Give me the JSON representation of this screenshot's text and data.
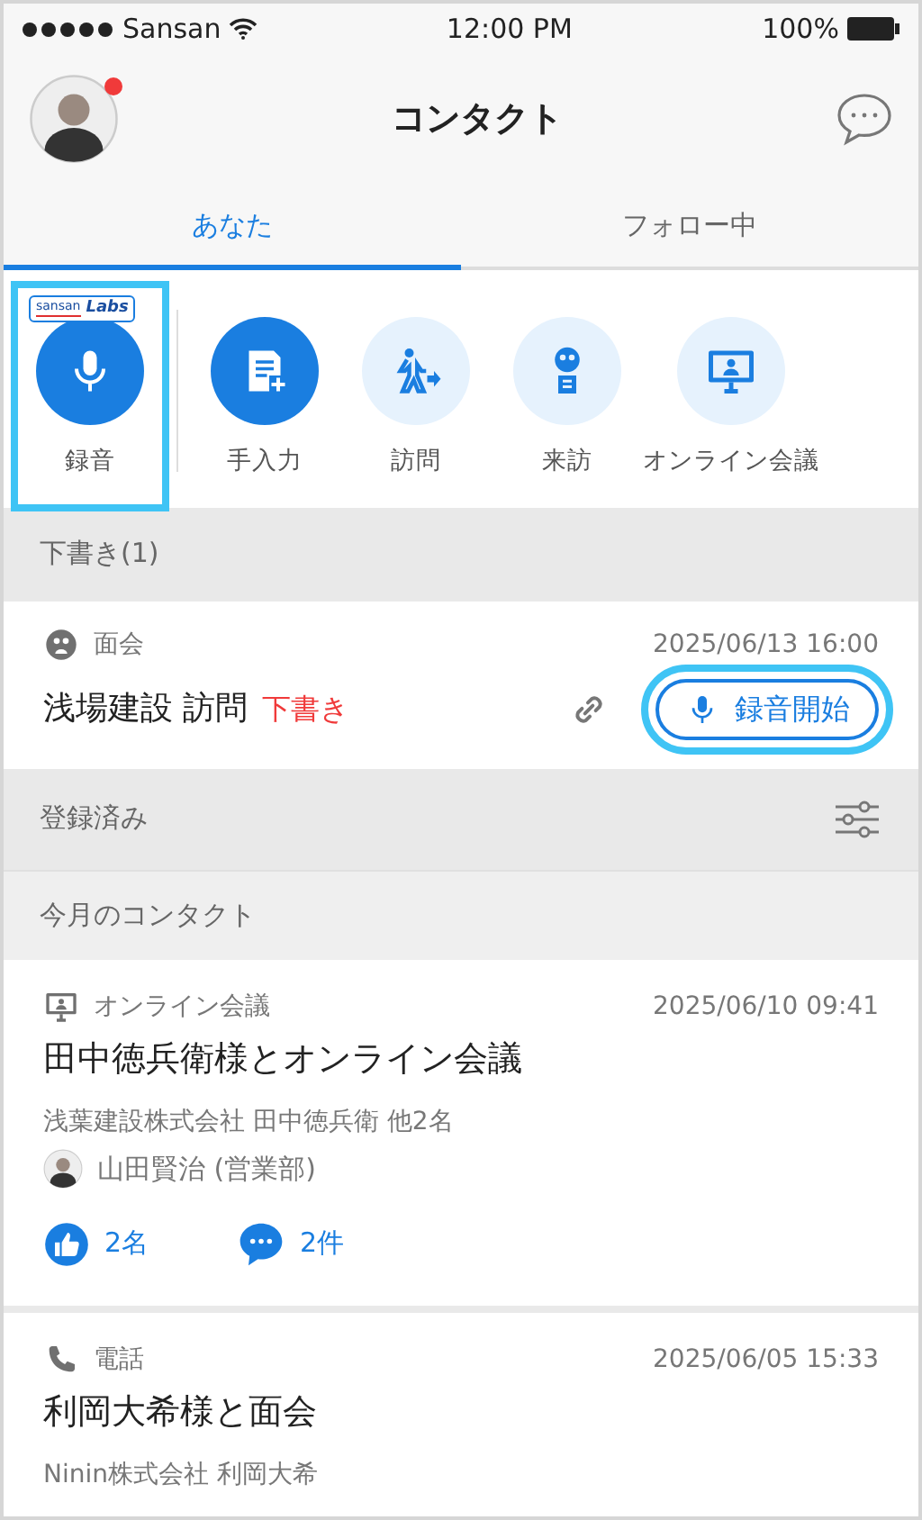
{
  "status_bar": {
    "carrier": "Sansan",
    "time": "12:00 PM",
    "battery": "100%"
  },
  "header": {
    "title": "コンタクト",
    "notification": true
  },
  "tabs": [
    {
      "label": "あなた",
      "selected": true
    },
    {
      "label": "フォロー中",
      "selected": false
    }
  ],
  "actions": [
    {
      "label": "録音",
      "kind": "record",
      "filled": true,
      "highlighted": true,
      "badge": {
        "brand": "sansan",
        "label": "Labs"
      }
    },
    {
      "label": "手入力",
      "kind": "manual",
      "filled": true,
      "highlighted": false
    },
    {
      "label": "訪問",
      "kind": "visit",
      "filled": false,
      "highlighted": false
    },
    {
      "label": "来訪",
      "kind": "reception",
      "filled": false,
      "highlighted": false
    },
    {
      "label": "オンライン会議",
      "kind": "online",
      "filled": false,
      "highlighted": false
    }
  ],
  "drafts": {
    "heading": "下書き(1)",
    "items": [
      {
        "kind": "meeting",
        "type": "面会",
        "datetime": "2025/06/13 16:00",
        "title": "浅場建設 訪問",
        "status": "下書き",
        "record_button": {
          "label": "録音開始",
          "highlighted": true
        }
      }
    ]
  },
  "registered": {
    "heading": "登録済み"
  },
  "month": {
    "heading": "今月のコンタクト"
  },
  "contacts": [
    {
      "kind": "online",
      "type": "オンライン会議",
      "datetime": "2025/06/10 09:41",
      "title": "田中徳兵衛様とオンライン会議",
      "company": "浅葉建設株式会社 田中徳兵衛 他2名",
      "owner": "山田賢治 (営業部)",
      "likes": "2名",
      "comments": "2件"
    },
    {
      "kind": "phone",
      "type": "電話",
      "datetime": "2025/06/05 15:33",
      "title": "利岡大希様と面会",
      "company": "Ninin株式会社 利岡大希"
    }
  ]
}
